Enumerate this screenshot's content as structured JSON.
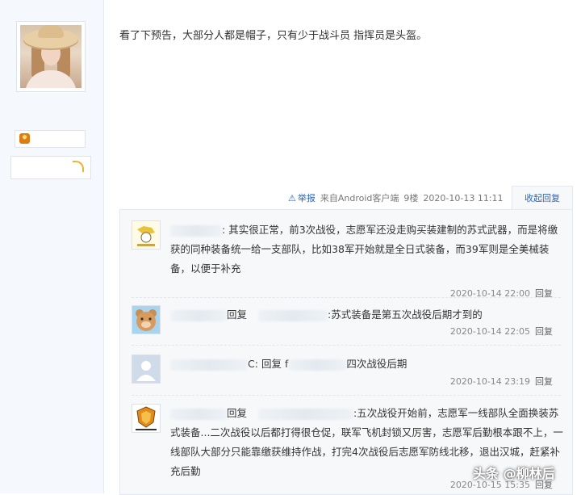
{
  "post": {
    "text": "看了下预告，大部分人都是帽子，只有少于战斗员 指挥员是头盔。",
    "report_label": "举报",
    "source": "来自Android客户端",
    "floor": "9楼",
    "time": "2020-10-13 11:11",
    "collapse_label": "收起回复"
  },
  "replies": [
    {
      "prefix": ":",
      "text": "其实很正常，前3次战役，志愿军还没走购买装建制的苏式武器，而是将缴获的同种装备统一给一支部队，比如38军开始就是全日式装备，而39军则是全美械装备，以便于补充",
      "time": "2020-10-14 22:00",
      "reply_label": "回复",
      "avatar_icon": "cartoon-icon"
    },
    {
      "reply_word": "回复",
      "text": ":苏式装备是第五次战役后期才到的",
      "time": "2020-10-14 22:05",
      "reply_label": "回复",
      "avatar_icon": "bear-icon"
    },
    {
      "name_suffix": "C:",
      "reply_word": "回复",
      "name_part": "f",
      "text": "四次战役后期",
      "time": "2020-10-14 23:19",
      "reply_label": "回复",
      "avatar_icon": "default-user-icon"
    },
    {
      "reply_word": "回复",
      "text_line1": ":五次战役开始前，志愿军一线部队全面换",
      "text_line2": "装苏式装备...二次战役以后都打得很仓促，联军飞机封锁又厉害，志愿军后勤根本跟不上，一线部队大部分只能靠缴获维持作战，打完4次战役后志愿军防线北移，退出汉城，赶紧补充后勤",
      "time": "2020-10-15 15:35",
      "reply_label": "回复",
      "avatar_icon": "shield-logo-icon"
    }
  ],
  "watermark": "头条 @柳林后",
  "colors": {
    "link": "#2d64b3",
    "sidebar_bg": "#f5f8fc",
    "reply_bg": "#f7f8fa"
  }
}
